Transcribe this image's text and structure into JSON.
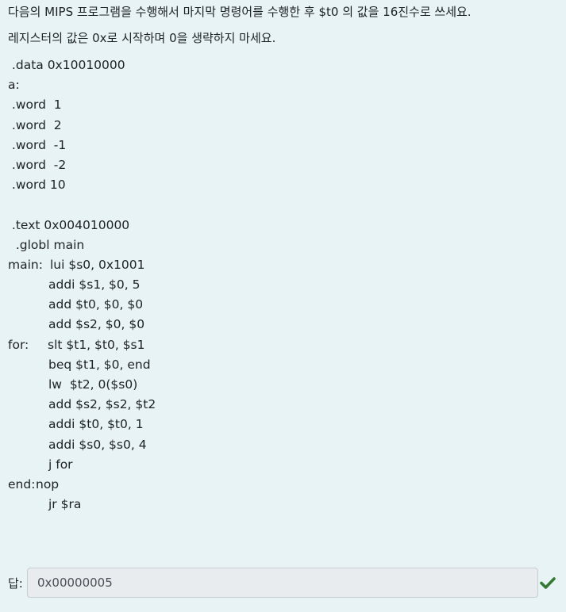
{
  "question": {
    "line1": "다음의 MIPS 프로그램을 수행해서 마지막 명령어를 수행한 후 $t0 의 값을 16진수로 쓰세요.",
    "line2": "레지스터의 값은 0x로 시작하며 0을 생략하지 마세요."
  },
  "code": [
    {
      "label": "",
      "instr": " .data 0x10010000"
    },
    {
      "label": "a:",
      "instr": ""
    },
    {
      "label": "",
      "instr": " .word  1"
    },
    {
      "label": "",
      "instr": " .word  2"
    },
    {
      "label": "",
      "instr": " .word  -1"
    },
    {
      "label": "",
      "instr": " .word  -2"
    },
    {
      "label": "",
      "instr": " .word 10"
    },
    {
      "label": "",
      "instr": ""
    },
    {
      "label": "",
      "instr": " .text 0x004010000"
    },
    {
      "label": "",
      "instr": "  .globl main"
    },
    {
      "label": "main:",
      "instr": "lui $s0, 0x1001"
    },
    {
      "label": "",
      "instr": "addi $s1, $0, 5"
    },
    {
      "label": "",
      "instr": "add $t0, $0, $0"
    },
    {
      "label": "",
      "instr": "add $s2, $0, $0"
    },
    {
      "label": "for:",
      "instr": "slt $t1, $t0, $s1"
    },
    {
      "label": "",
      "instr": "beq $t1, $0, end"
    },
    {
      "label": "",
      "instr": "lw  $t2, 0($s0)"
    },
    {
      "label": "",
      "instr": "add $s2, $s2, $t2"
    },
    {
      "label": "",
      "instr": "addi $t0, $t0, 1"
    },
    {
      "label": "",
      "instr": "addi $s0, $s0, 4"
    },
    {
      "label": "",
      "instr": "j for"
    },
    {
      "label": "end:",
      "instr": "nop"
    },
    {
      "label": "",
      "instr": "jr $ra"
    }
  ],
  "answer": {
    "label": "답:",
    "value": "0x00000005"
  },
  "status": {
    "icon": "check-icon",
    "color": "#357a32"
  }
}
